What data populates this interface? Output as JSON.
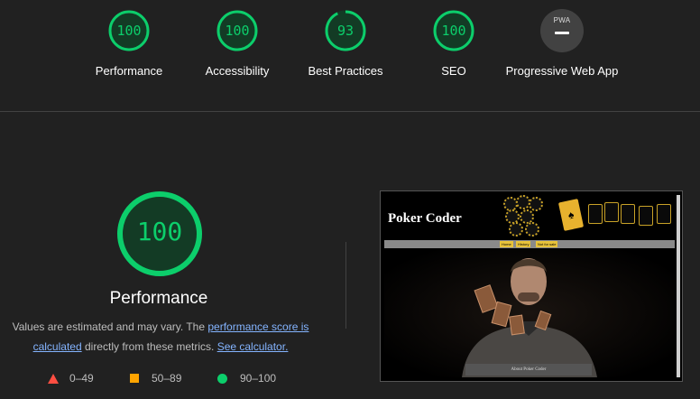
{
  "top_scores": [
    {
      "label": "Performance",
      "score": "100",
      "value": 100
    },
    {
      "label": "Accessibility",
      "score": "100",
      "value": 100
    },
    {
      "label": "Best Practices",
      "score": "93",
      "value": 93
    },
    {
      "label": "SEO",
      "score": "100",
      "value": 100
    }
  ],
  "pwa": {
    "badge": "PWA",
    "label": "Progressive Web App"
  },
  "main": {
    "score": "100",
    "value": 100,
    "title": "Performance",
    "desc_before": "Values are estimated and may vary. The ",
    "link_score": "performance score is calculated",
    "desc_middle": " directly from these metrics. ",
    "link_calc": "See calculator."
  },
  "legend": [
    {
      "range": "0–49"
    },
    {
      "range": "50–89"
    },
    {
      "range": "90–100"
    }
  ],
  "screenshot": {
    "site_title": "Poker Coder",
    "nav": [
      "Home",
      "History",
      "Not for sale"
    ],
    "about": "About Poker Coder"
  },
  "colors": {
    "pass": "#0cce6b",
    "average": "#ffa400",
    "fail": "#ff4e42"
  }
}
